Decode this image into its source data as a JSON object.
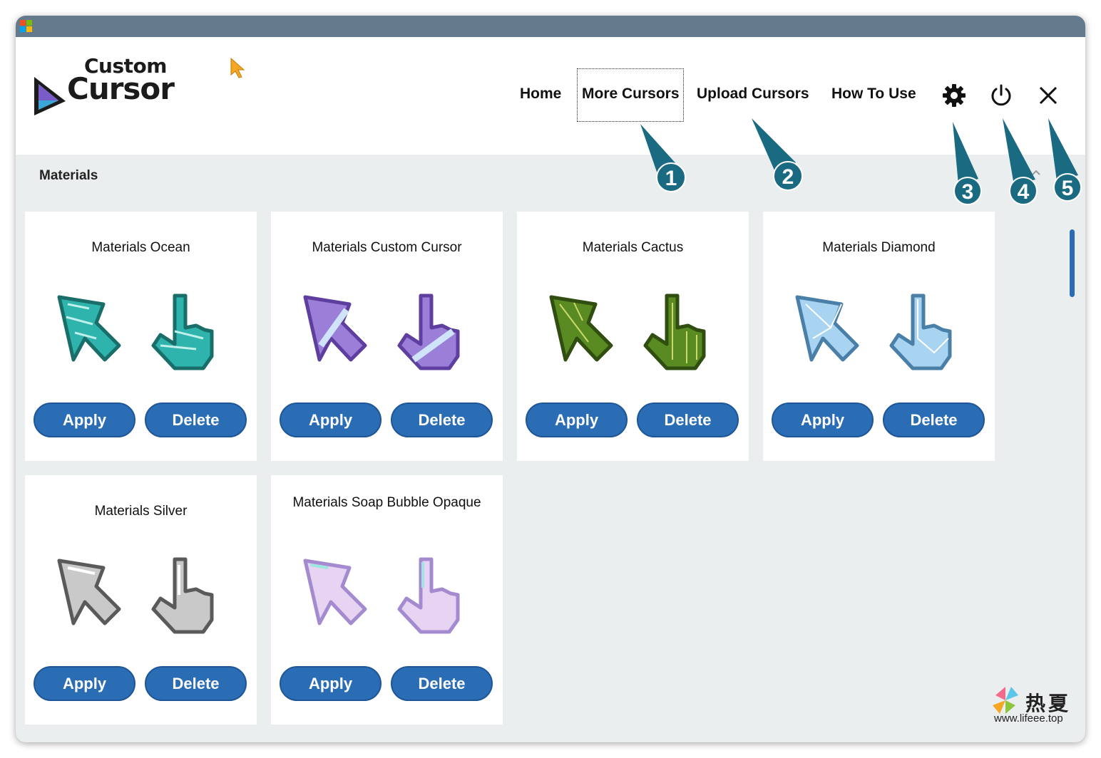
{
  "app": {
    "logo_small": "Custom",
    "logo_big": "Cursor"
  },
  "nav": {
    "items": [
      {
        "label": "Home"
      },
      {
        "label": "More Cursors"
      },
      {
        "label": "Upload Cursors"
      },
      {
        "label": "How To Use"
      }
    ],
    "icons": [
      "gear-icon",
      "power-icon",
      "close-icon"
    ]
  },
  "section": {
    "title": "Materials"
  },
  "cards": [
    {
      "title": "Materials Ocean",
      "apply": "Apply",
      "delete": "Delete",
      "color": "#2fb3ad"
    },
    {
      "title": "Materials Custom Cursor",
      "apply": "Apply",
      "delete": "Delete",
      "color": "#9a7ed8"
    },
    {
      "title": "Materials Cactus",
      "apply": "Apply",
      "delete": "Delete",
      "color": "#5a8a22"
    },
    {
      "title": "Materials Diamond",
      "apply": "Apply",
      "delete": "Delete",
      "color": "#a8d4f2"
    },
    {
      "title": "Materials Silver",
      "apply": "Apply",
      "delete": "Delete",
      "color": "#c9c9c9"
    },
    {
      "title": "Materials Soap Bubble Opaque",
      "apply": "Apply",
      "delete": "Delete",
      "color": "#e6d4f2"
    }
  ],
  "callouts": [
    "1",
    "2",
    "3",
    "4",
    "5"
  ],
  "watermark": {
    "cn": "热夏",
    "url": "www.lifeee.top"
  },
  "colors": {
    "accent": "#2a6db5",
    "callout": "#1a6a82",
    "titlebar": "#667a8e"
  }
}
